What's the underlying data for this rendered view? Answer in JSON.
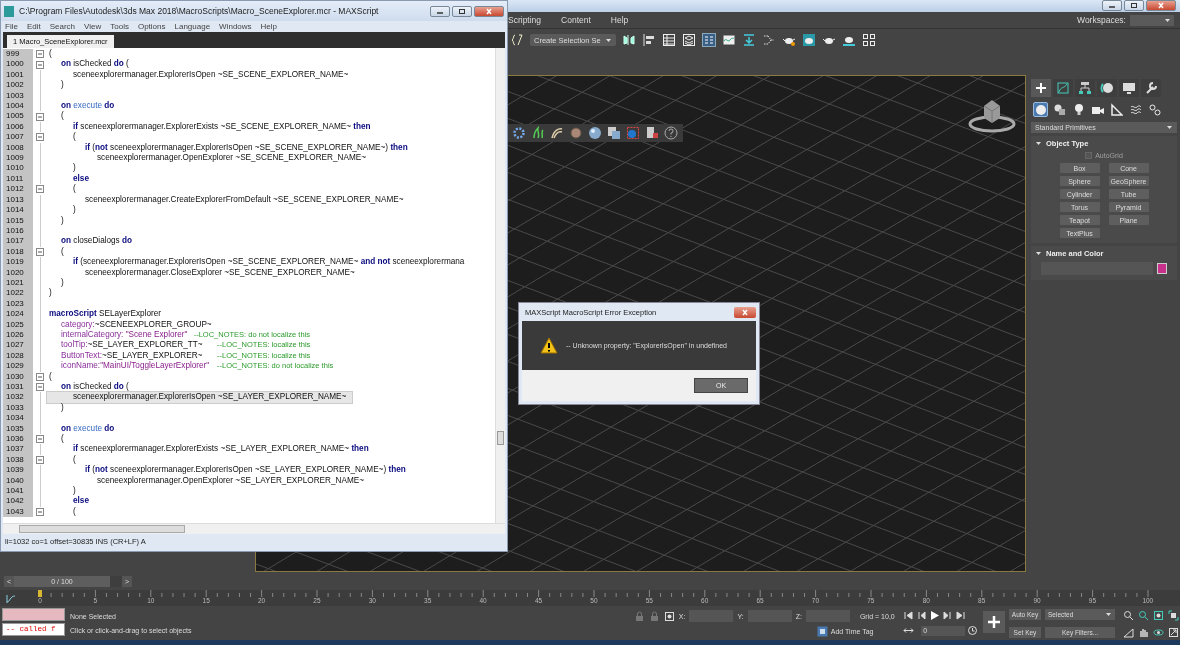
{
  "app": {
    "menu": [
      "Scripting",
      "Content",
      "Help"
    ],
    "workspaces_label": "Workspaces:",
    "selection_set": "Create Selection Se"
  },
  "editor": {
    "title": "C:\\Program Files\\Autodesk\\3ds Max 2018\\MacroScripts\\Macro_SceneExplorer.mcr - MAXScript",
    "menu": [
      "File",
      "Edit",
      "Search",
      "View",
      "Tools",
      "Options",
      "Language",
      "Windows",
      "Help"
    ],
    "tabs": [
      {
        "label": "1 Macro_SceneExplorer.mcr",
        "selected": true
      }
    ],
    "lines": [
      {
        "number": "999",
        "fold": true,
        "current": false,
        "parts": [
          {
            "text": "(",
            "kind": "plain"
          }
        ]
      },
      {
        "number": "1000",
        "fold": true,
        "current": false,
        "parts": [
          {
            "text": "\ton",
            "kind": "keyword"
          },
          {
            "text": " isChecked ",
            "kind": "plain"
          },
          {
            "text": "do",
            "kind": "keyword"
          },
          {
            "text": " (",
            "kind": "plain"
          }
        ]
      },
      {
        "number": "1001",
        "fold": false,
        "current": false,
        "parts": [
          {
            "text": "\t\tsceneexplorermanager.ExplorerIsOpen ~SE_SCENE_EXPLORER_NAME~",
            "kind": "plain"
          }
        ]
      },
      {
        "number": "1002",
        "fold": false,
        "current": false,
        "parts": [
          {
            "text": "\t)",
            "kind": "plain"
          }
        ]
      },
      {
        "number": "1003",
        "fold": false,
        "current": false
      },
      {
        "number": "1004",
        "fold": false,
        "current": false,
        "parts": [
          {
            "text": "\ton",
            "kind": "keyword"
          },
          {
            "text": " execute ",
            "kind": "event"
          },
          {
            "text": "do",
            "kind": "keyword"
          }
        ]
      },
      {
        "number": "1005",
        "fold": true,
        "current": false,
        "parts": [
          {
            "text": "\t(",
            "kind": "plain"
          }
        ]
      },
      {
        "number": "1006",
        "fold": false,
        "current": false,
        "parts": [
          {
            "text": "\t\tif",
            "kind": "keyword"
          },
          {
            "text": " sceneexplorermanager.ExplorerExists ~SE_SCENE_EXPLORER_NAME~ ",
            "kind": "plain"
          },
          {
            "text": "then",
            "kind": "keyword"
          }
        ]
      },
      {
        "number": "1007",
        "fold": true,
        "current": false,
        "parts": [
          {
            "text": "\t\t(",
            "kind": "plain"
          }
        ]
      },
      {
        "number": "1008",
        "fold": false,
        "current": false,
        "parts": [
          {
            "text": "\t\t\tif",
            "kind": "keyword"
          },
          {
            "text": " (",
            "kind": "plain"
          },
          {
            "text": "not",
            "kind": "keyword"
          },
          {
            "text": " sceneexplorermanager.ExplorerIsOpen ~SE_SCENE_EXPLORER_NAME~) ",
            "kind": "plain"
          },
          {
            "text": "then",
            "kind": "keyword"
          }
        ]
      },
      {
        "number": "1009",
        "fold": false,
        "current": false,
        "parts": [
          {
            "text": "\t\t\t\tsceneexplorermanager.OpenExplorer ~SE_SCENE_EXPLORER_NAME~",
            "kind": "plain"
          }
        ]
      },
      {
        "number": "1010",
        "fold": false,
        "current": false,
        "parts": [
          {
            "text": "\t\t)",
            "kind": "plain"
          }
        ]
      },
      {
        "number": "1011",
        "fold": false,
        "current": false,
        "parts": [
          {
            "text": "\t\telse",
            "kind": "keyword"
          }
        ]
      },
      {
        "number": "1012",
        "fold": true,
        "current": false,
        "parts": [
          {
            "text": "\t\t(",
            "kind": "plain"
          }
        ]
      },
      {
        "number": "1013",
        "fold": false,
        "current": false,
        "parts": [
          {
            "text": "\t\t\tsceneexplorermanager.CreateExplorerFromDefault ~SE_SCENE_EXPLORER_NAME~",
            "kind": "plain"
          }
        ]
      },
      {
        "number": "1014",
        "fold": false,
        "current": false,
        "parts": [
          {
            "text": "\t\t)",
            "kind": "plain"
          }
        ]
      },
      {
        "number": "1015",
        "fold": false,
        "current": false,
        "parts": [
          {
            "text": "\t)",
            "kind": "plain"
          }
        ]
      },
      {
        "number": "1016",
        "fold": false,
        "current": false
      },
      {
        "number": "1017",
        "fold": false,
        "current": false,
        "parts": [
          {
            "text": "\ton",
            "kind": "keyword"
          },
          {
            "text": " closeDialogs ",
            "kind": "plain"
          },
          {
            "text": "do",
            "kind": "keyword"
          }
        ]
      },
      {
        "number": "1018",
        "fold": true,
        "current": false,
        "parts": [
          {
            "text": "\t(",
            "kind": "plain"
          }
        ]
      },
      {
        "number": "1019",
        "fold": false,
        "current": false,
        "parts": [
          {
            "text": "\t\tif",
            "kind": "keyword"
          },
          {
            "text": " (sceneexplorermanager.ExplorerIsOpen ~SE_SCENE_EXPLORER_NAME~ ",
            "kind": "plain"
          },
          {
            "text": "and not",
            "kind": "keyword"
          },
          {
            "text": " sceneexplorermana",
            "kind": "plain"
          }
        ]
      },
      {
        "number": "1020",
        "fold": false,
        "current": false,
        "parts": [
          {
            "text": "\t\t\tsceneexplorermanager.CloseExplorer ~SE_SCENE_EXPLORER_NAME~",
            "kind": "plain"
          }
        ]
      },
      {
        "number": "1021",
        "fold": false,
        "current": false,
        "parts": [
          {
            "text": "\t)",
            "kind": "plain"
          }
        ]
      },
      {
        "number": "1022",
        "fold": false,
        "current": false,
        "parts": [
          {
            "text": ")",
            "kind": "plain"
          }
        ]
      },
      {
        "number": "1023",
        "fold": false,
        "current": false
      },
      {
        "number": "1024",
        "fold": false,
        "current": false,
        "parts": [
          {
            "text": "macroScript",
            "kind": "keyword"
          },
          {
            "text": " SELayerExplorer",
            "kind": "plain"
          }
        ]
      },
      {
        "number": "1025",
        "fold": false,
        "current": false,
        "parts": [
          {
            "text": "\tcategory:",
            "kind": "property"
          },
          {
            "text": "~SCENEEXPLORER_GROUP~",
            "kind": "plain"
          }
        ]
      },
      {
        "number": "1026",
        "fold": false,
        "current": false,
        "parts": [
          {
            "text": "\tinternalCategory: ",
            "kind": "property"
          },
          {
            "text": "\"Scene Explorer\"",
            "kind": "string"
          },
          {
            "text": "   --LOC_NOTES: do not localize this",
            "kind": "comment"
          }
        ]
      },
      {
        "number": "1027",
        "fold": false,
        "current": false,
        "parts": [
          {
            "text": "\ttoolTip:",
            "kind": "property"
          },
          {
            "text": "~SE_LAYER_EXPLORER_TT~",
            "kind": "plain"
          },
          {
            "text": "\t\t--LOC_NOTES: localize this",
            "kind": "comment"
          }
        ]
      },
      {
        "number": "1028",
        "fold": false,
        "current": false,
        "parts": [
          {
            "text": "\tButtonText:",
            "kind": "property"
          },
          {
            "text": "~SE_LAYER_EXPLORER~",
            "kind": "plain"
          },
          {
            "text": "\t\t--LOC_NOTES: localize this",
            "kind": "comment"
          }
        ]
      },
      {
        "number": "1029",
        "fold": false,
        "current": false,
        "parts": [
          {
            "text": "\ticonName:",
            "kind": "property"
          },
          {
            "text": "\"MainUI/ToggleLayerExplorer\"",
            "kind": "string"
          },
          {
            "text": "\t--LOC_NOTES: do not localize this",
            "kind": "comment"
          }
        ]
      },
      {
        "number": "1030",
        "fold": true,
        "current": false,
        "parts": [
          {
            "text": "(",
            "kind": "plain"
          }
        ]
      },
      {
        "number": "1031",
        "fold": true,
        "current": false,
        "parts": [
          {
            "text": "\ton",
            "kind": "keyword"
          },
          {
            "text": " isChecked ",
            "kind": "plain"
          },
          {
            "text": "do",
            "kind": "keyword"
          },
          {
            "text": " (",
            "kind": "plain"
          }
        ]
      },
      {
        "number": "1032",
        "fold": false,
        "current": true,
        "parts": [
          {
            "text": "\t\tsceneexplorermanager.ExplorerIsOpen ~SE_LAYER_EXPLORER_NAME~",
            "kind": "plain"
          }
        ]
      },
      {
        "number": "1033",
        "fold": false,
        "current": false,
        "parts": [
          {
            "text": "\t)",
            "kind": "plain"
          }
        ]
      },
      {
        "number": "1034",
        "fold": false,
        "current": false
      },
      {
        "number": "1035",
        "fold": false,
        "current": false,
        "parts": [
          {
            "text": "\ton",
            "kind": "keyword"
          },
          {
            "text": " execute ",
            "kind": "event"
          },
          {
            "text": "do",
            "kind": "keyword"
          }
        ]
      },
      {
        "number": "1036",
        "fold": true,
        "current": false,
        "parts": [
          {
            "text": "\t(",
            "kind": "plain"
          }
        ]
      },
      {
        "number": "1037",
        "fold": false,
        "current": false,
        "parts": [
          {
            "text": "\t\tif",
            "kind": "keyword"
          },
          {
            "text": " sceneexplorermanager.ExplorerExists ~SE_LAYER_EXPLORER_NAME~ ",
            "kind": "plain"
          },
          {
            "text": "then",
            "kind": "keyword"
          }
        ]
      },
      {
        "number": "1038",
        "fold": true,
        "current": false,
        "parts": [
          {
            "text": "\t\t(",
            "kind": "plain"
          }
        ]
      },
      {
        "number": "1039",
        "fold": false,
        "current": false,
        "parts": [
          {
            "text": "\t\t\tif",
            "kind": "keyword"
          },
          {
            "text": " (",
            "kind": "plain"
          },
          {
            "text": "not",
            "kind": "keyword"
          },
          {
            "text": " sceneexplorermanager.ExplorerIsOpen ~SE_LAYER_EXPLORER_NAME~) ",
            "kind": "plain"
          },
          {
            "text": "then",
            "kind": "keyword"
          }
        ]
      },
      {
        "number": "1040",
        "fold": false,
        "current": false,
        "parts": [
          {
            "text": "\t\t\t\tsceneexplorermanager.OpenExplorer ~SE_LAYER_EXPLORER_NAME~",
            "kind": "plain"
          }
        ]
      },
      {
        "number": "1041",
        "fold": false,
        "current": false,
        "parts": [
          {
            "text": "\t\t)",
            "kind": "plain"
          }
        ]
      },
      {
        "number": "1042",
        "fold": false,
        "current": false,
        "parts": [
          {
            "text": "\t\telse",
            "kind": "keyword"
          }
        ]
      },
      {
        "number": "1043",
        "fold": true,
        "current": false,
        "parts": [
          {
            "text": "\t\t(",
            "kind": "plain"
          }
        ]
      }
    ],
    "status": "li=1032 co=1 offset=30835 INS (CR+LF) A"
  },
  "command_panel": {
    "tabs": [
      {
        "selected": true
      },
      {
        "selected": false
      },
      {
        "selected": false
      },
      {
        "selected": false
      },
      {
        "selected": false
      },
      {
        "selected": false
      }
    ],
    "categories": [
      {
        "selected": true
      },
      {
        "selected": false
      },
      {
        "selected": false
      },
      {
        "selected": false
      },
      {
        "selected": false
      },
      {
        "selected": false
      },
      {
        "selected": false
      }
    ],
    "primitive_type": "Standard Primitives",
    "object_type": {
      "title": "Object Type",
      "autogrid": {
        "label": "AutoGrid",
        "checked": false,
        "disabled": true
      },
      "buttons": [
        "Box",
        "Cone",
        "Sphere",
        "GeoSphere",
        "Cylinder",
        "Tube",
        "Torus",
        "Pyramid",
        "Teapot",
        "Plane",
        "TextPlus"
      ]
    },
    "name_and_color": {
      "title": "Name and Color",
      "color": "#c8308c"
    }
  },
  "dialog": {
    "title": "MAXScript MacroScript Error Exception",
    "message": "-- Unknown property: \"ExplorerIsOpen\" in undefined",
    "button": "OK"
  },
  "timeline": {
    "prev": "<",
    "range": "0 / 100",
    "level": 0,
    "next": ">",
    "ticks": [
      "0",
      "5",
      "10",
      "15",
      "20",
      "25",
      "30",
      "35",
      "40",
      "45",
      "50",
      "55",
      "60",
      "65",
      "70",
      "75",
      "80",
      "85",
      "90",
      "95",
      "100"
    ]
  },
  "status_bar": {
    "listener_output": "-- called f",
    "selection": "None Selected",
    "prompt": "Click or click-and-drag to select objects",
    "x_label": "X:",
    "y_label": "Y:",
    "z_label": "Z:",
    "grid": "Grid = 10,0",
    "time_tag": "Add Time Tag",
    "frame": "0",
    "auto_key": "Auto Key",
    "key_mode": "Selected",
    "set_key": "Set Key",
    "key_filters": "Key Filters..."
  }
}
